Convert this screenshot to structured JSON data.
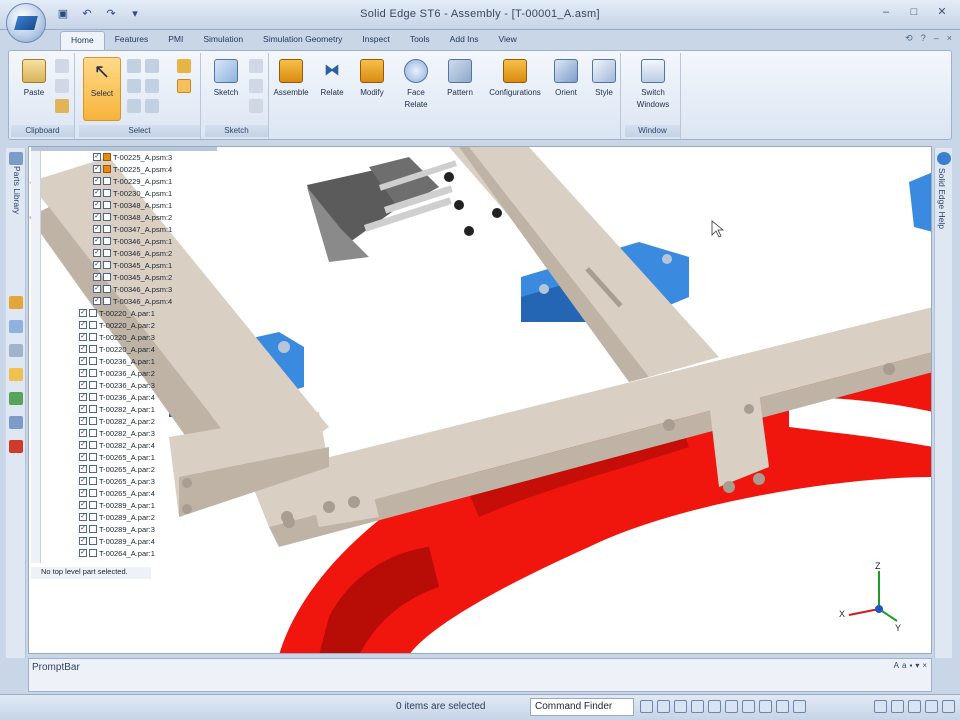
{
  "window": {
    "title": "Solid Edge ST6 - Assembly - [T-00001_A.asm]",
    "controls": [
      "–",
      "□",
      "✕"
    ]
  },
  "quick_access": [
    "save-icon",
    "undo-icon",
    "redo-icon",
    "customize-icon"
  ],
  "ribbon": {
    "tabs": [
      "Home",
      "Features",
      "PMI",
      "Simulation",
      "Simulation Geometry",
      "Inspect",
      "Tools",
      "Add Ins",
      "View"
    ],
    "active_tab": "Home",
    "right_controls": [
      "⟲",
      "?",
      "–",
      "×"
    ],
    "groups": [
      {
        "label": "Clipboard",
        "buttons": [
          "Paste"
        ]
      },
      {
        "label": "Select",
        "buttons": [
          "Select"
        ]
      },
      {
        "label": "Sketch",
        "buttons": [
          "Sketch"
        ]
      },
      {
        "label": "",
        "buttons": [
          "Assemble",
          "Relate",
          "Modify",
          "Face Relate",
          "Pattern",
          "Configurations",
          "Orient",
          "Style"
        ]
      },
      {
        "label": "Window",
        "buttons": [
          "Switch Windows"
        ]
      }
    ],
    "labels": {
      "paste": "Paste",
      "select": "Select",
      "sketch": "Sketch",
      "assemble": "Assemble",
      "relate": "Relate",
      "modify": "Modify",
      "face_relate_1": "Face",
      "face_relate_2": "Relate",
      "pattern": "Pattern",
      "configurations": "Configurations",
      "orient": "Orient",
      "style": "Style",
      "switch_1": "Switch",
      "switch_2": "Windows",
      "clipboard_group": "Clipboard",
      "select_group": "Select",
      "sketch_group": "Sketch",
      "window_group": "Window"
    }
  },
  "side_panels": {
    "parts_library": "Parts Library",
    "help": "Solid Edge Help"
  },
  "tree": {
    "items": [
      {
        "label": "T-00225_A.psm:3",
        "level": 1,
        "type": "sheet"
      },
      {
        "label": "T-00225_A.psm:4",
        "level": 1,
        "type": "sheet"
      },
      {
        "label": "T-00229_A.psm:1",
        "level": 1,
        "type": "box"
      },
      {
        "label": "T-00230_A.psm:1",
        "level": 1,
        "type": "box"
      },
      {
        "label": "T-00348_A.psm:1",
        "level": 1,
        "type": "box"
      },
      {
        "label": "T-00348_A.psm:2",
        "level": 1,
        "type": "box"
      },
      {
        "label": "T-00347_A.psm:1",
        "level": 1,
        "type": "box"
      },
      {
        "label": "T-00346_A.psm:1",
        "level": 1,
        "type": "box"
      },
      {
        "label": "T-00346_A.psm:2",
        "level": 1,
        "type": "box"
      },
      {
        "label": "T-00345_A.psm:1",
        "level": 1,
        "type": "box"
      },
      {
        "label": "T-00345_A.psm:2",
        "level": 1,
        "type": "box"
      },
      {
        "label": "T-00346_A.psm:3",
        "level": 1,
        "type": "box"
      },
      {
        "label": "T-00346_A.psm:4",
        "level": 1,
        "type": "box"
      },
      {
        "label": "T-00220_A.par:1",
        "level": 0,
        "type": "box"
      },
      {
        "label": "T-00220_A.par:2",
        "level": 0,
        "type": "box"
      },
      {
        "label": "T-00220_A.par:3",
        "level": 0,
        "type": "box"
      },
      {
        "label": "T-00220_A.par:4",
        "level": 0,
        "type": "box"
      },
      {
        "label": "T-00236_A.par:1",
        "level": 0,
        "type": "box"
      },
      {
        "label": "T-00236_A.par:2",
        "level": 0,
        "type": "box"
      },
      {
        "label": "T-00236_A.par:3",
        "level": 0,
        "type": "box"
      },
      {
        "label": "T-00236_A.par:4",
        "level": 0,
        "type": "box"
      },
      {
        "label": "T-00282_A.par:1",
        "level": 0,
        "type": "box"
      },
      {
        "label": "T-00282_A.par:2",
        "level": 0,
        "type": "box"
      },
      {
        "label": "T-00282_A.par:3",
        "level": 0,
        "type": "box"
      },
      {
        "label": "T-00282_A.par:4",
        "level": 0,
        "type": "box"
      },
      {
        "label": "T-00265_A.par:1",
        "level": 0,
        "type": "box"
      },
      {
        "label": "T-00265_A.par:2",
        "level": 0,
        "type": "box"
      },
      {
        "label": "T-00265_A.par:3",
        "level": 0,
        "type": "box"
      },
      {
        "label": "T-00265_A.par:4",
        "level": 0,
        "type": "box"
      },
      {
        "label": "T-00289_A.par:1",
        "level": 0,
        "type": "box"
      },
      {
        "label": "T-00289_A.par:2",
        "level": 0,
        "type": "box"
      },
      {
        "label": "T-00289_A.par:3",
        "level": 0,
        "type": "box"
      },
      {
        "label": "T-00289_A.par:4",
        "level": 0,
        "type": "box"
      },
      {
        "label": "T-00264_A.par:1",
        "level": 0,
        "type": "box"
      }
    ],
    "status": "No top level part selected."
  },
  "triad": {
    "x": "X",
    "y": "Y",
    "z": "Z"
  },
  "promptbar": {
    "title": "PromptBar"
  },
  "statusbar": {
    "selection": "0 items are selected",
    "command_finder": "Command Finder"
  },
  "colors": {
    "frame": "#d9cfc3",
    "bracket": "#3a8be0",
    "red_part": "#f0160e",
    "dark_part": "#5b5b5b",
    "ribbon_selected": "#f7b43c"
  }
}
